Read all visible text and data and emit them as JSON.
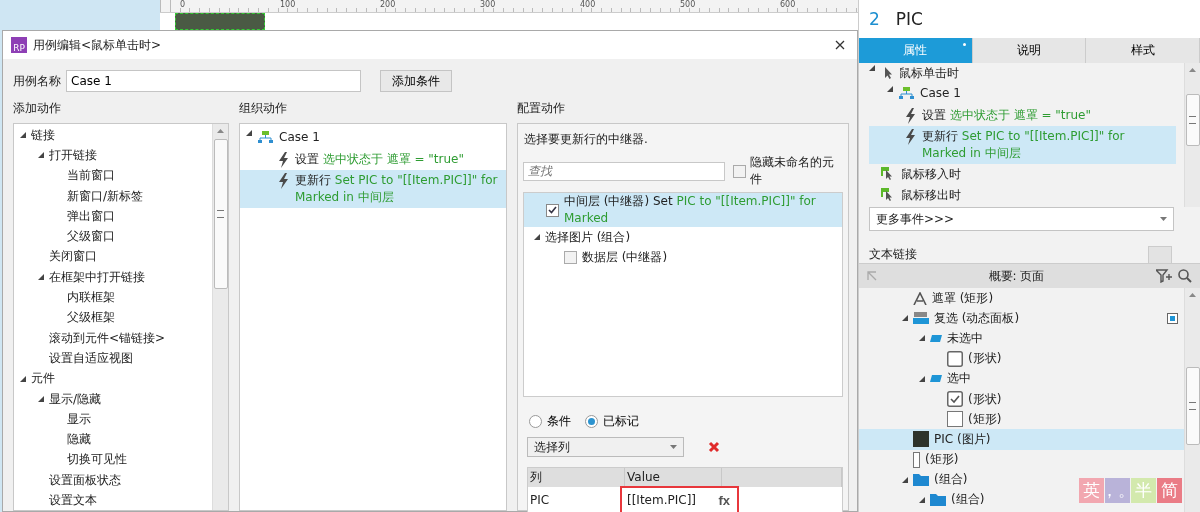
{
  "canvas": {
    "ruler_ticks": [
      "0",
      "100",
      "200",
      "300",
      "400",
      "500",
      "600"
    ]
  },
  "dialog": {
    "logo": "RP",
    "title": "用例编辑<鼠标单击时>",
    "case_name_label": "用例名称",
    "case_name": "Case 1",
    "add_condition_button": "添加条件",
    "add_actions": {
      "heading": "添加动作",
      "tree": [
        {
          "label": "链接",
          "expanded": true,
          "children": [
            {
              "label": "打开链接",
              "expanded": true,
              "children": [
                {
                  "label": "当前窗口"
                },
                {
                  "label": "新窗口/新标签"
                },
                {
                  "label": "弹出窗口"
                },
                {
                  "label": "父级窗口"
                }
              ]
            },
            {
              "label": "关闭窗口"
            },
            {
              "label": "在框架中打开链接",
              "expanded": true,
              "children": [
                {
                  "label": "内联框架"
                },
                {
                  "label": "父级框架"
                }
              ]
            },
            {
              "label": "滚动到元件<锚链接>"
            },
            {
              "label": "设置自适应视图"
            }
          ]
        },
        {
          "label": "元件",
          "expanded": true,
          "children": [
            {
              "label": "显示/隐藏",
              "expanded": true,
              "children": [
                {
                  "label": "显示"
                },
                {
                  "label": "隐藏"
                },
                {
                  "label": "切换可见性"
                }
              ]
            },
            {
              "label": "设置面板状态"
            },
            {
              "label": "设置文本"
            }
          ]
        }
      ]
    },
    "organize_actions": {
      "heading": "组织动作",
      "tree": [
        {
          "kind": "case",
          "label": "Case 1",
          "expanded": true,
          "selected": false,
          "children": [
            {
              "kind": "action",
              "label": "设置",
              "detail": "选中状态于 遮罩 = \"true\"",
              "selected": false
            },
            {
              "kind": "action",
              "label": "更新行",
              "detail": "Set PIC to \"[[Item.PIC]]\" for Marked in 中间层",
              "selected": true
            }
          ]
        }
      ]
    },
    "configure_action": {
      "heading": "配置动作",
      "prompt": "选择要更新行的中继器.",
      "search": {
        "placeholder": "查找"
      },
      "hide_unnamed": {
        "label": "隐藏未命名的元件",
        "checked": false
      },
      "targets": [
        {
          "kind": "checkbox",
          "label": "中间层 (中继器) Set",
          "detail": "PIC to \"[[Item.PIC]]\" for Marked",
          "checked": true,
          "selected": true
        },
        {
          "kind": "group",
          "label": "选择图片 (组合)",
          "expanded": true,
          "selected": false,
          "children": [
            {
              "kind": "checkbox",
              "label": "数据层 (中继器)",
              "checked": false,
              "selected": false
            }
          ]
        }
      ],
      "row_filter": [
        {
          "label": "条件",
          "selected": false
        },
        {
          "label": "已标记",
          "selected": true
        }
      ],
      "column_select": "选择列",
      "table": {
        "columns": [
          "列",
          "Value"
        ],
        "rows": [
          {
            "cells": [
              {
                "text": "PIC",
                "highlighted": false
              },
              {
                "text": "[[Item.PIC]]",
                "highlighted": true,
                "fx": "fx"
              }
            ]
          }
        ]
      }
    }
  },
  "inspector": {
    "index": "2",
    "name": "PIC",
    "tabs": [
      {
        "label": "属性",
        "selected": true
      },
      {
        "label": "说明",
        "selected": false
      },
      {
        "label": "样式",
        "selected": false
      }
    ],
    "events": [
      {
        "kind": "event",
        "label": "鼠标单击时",
        "expanded": true,
        "children": [
          {
            "kind": "case",
            "label": "Case 1",
            "expanded": true,
            "children": [
              {
                "kind": "action",
                "label": "设置",
                "detail": "选中状态于 遮罩 = \"true\"",
                "selected": false
              },
              {
                "kind": "action",
                "label": "更新行",
                "detail": "Set PIC to \"[[Item.PIC]]\" for Marked in 中间层",
                "selected": true
              }
            ]
          }
        ]
      },
      {
        "kind": "event",
        "label": "鼠标移入时"
      },
      {
        "kind": "event",
        "label": "鼠标移出时"
      }
    ],
    "more_events": "更多事件>>>",
    "text_link_label": "文本链接"
  },
  "outline": {
    "title": "概要: 页面",
    "tree": [
      {
        "kind": "text",
        "label": "遮罩 (矩形)",
        "selected": false
      },
      {
        "kind": "dynamic-panel",
        "label": "复选 (动态面板)",
        "expanded": true,
        "selected": false,
        "marker": true,
        "children": [
          {
            "kind": "state",
            "label": "未选中",
            "expanded": true,
            "selected": false,
            "children": [
              {
                "kind": "shape-empty",
                "label": "(形状)",
                "selected": false
              }
            ]
          },
          {
            "kind": "state",
            "label": "选中",
            "expanded": true,
            "selected": false,
            "children": [
              {
                "kind": "shape-checked",
                "label": "(形状)",
                "selected": false
              },
              {
                "kind": "rect",
                "label": "(矩形)",
                "selected": false
              }
            ]
          }
        ]
      },
      {
        "kind": "image",
        "label": "PIC (图片)",
        "selected": true
      },
      {
        "kind": "rect-thin",
        "label": "(矩形)",
        "selected": false
      },
      {
        "kind": "group",
        "label": "(组合)",
        "expanded": true,
        "selected": false,
        "children": [
          {
            "kind": "group",
            "label": "(组合)",
            "expanded": true,
            "selected": false
          }
        ]
      }
    ]
  },
  "ime_bar": [
    {
      "text": "英",
      "color": "#f2a7b0"
    },
    {
      "text": "，。",
      "color": "#b9b3d9"
    },
    {
      "text": "半",
      "color": "#d3e9ad"
    },
    {
      "text": "简",
      "color": "#ea7c86"
    }
  ]
}
